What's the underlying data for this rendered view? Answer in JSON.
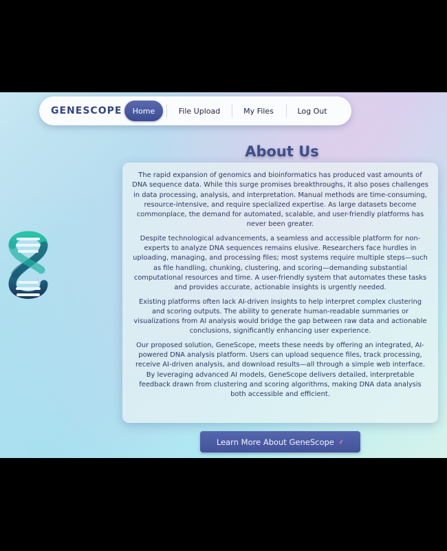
{
  "nav": {
    "brand": "GENESCOPE",
    "items": [
      {
        "label": "Home",
        "active": true
      },
      {
        "label": "File Upload"
      },
      {
        "label": "My Files"
      },
      {
        "label": "Log Out"
      }
    ]
  },
  "logo": {
    "icon": "dna-icon"
  },
  "main": {
    "title": "About Us",
    "paragraphs": [
      "The rapid expansion of genomics and bioinformatics has produced vast amounts of DNA sequence data. While this surge promises breakthroughs, it also poses challenges in data processing, analysis, and interpretation. Manual methods are time-consuming, resource-intensive, and require specialized expertise. As large datasets become commonplace, the demand for automated, scalable, and user-friendly platforms has never been greater.",
      "Despite technological advancements, a seamless and accessible platform for non-experts to analyze DNA sequences remains elusive. Researchers face hurdles in uploading, managing, and processing files; most systems require multiple steps—such as file handling, chunking, clustering, and scoring—demanding substantial computational resources and time. A user-friendly system that automates these tasks and provides accurate, actionable insights is urgently needed.",
      "Existing platforms often lack AI-driven insights to help interpret complex clustering and scoring outputs. The ability to generate human-readable summaries or visualizations from AI analysis would bridge the gap between raw data and actionable conclusions, significantly enhancing user experience.",
      "Our proposed solution, GeneScope, meets these needs by offering an integrated, AI-powered DNA analysis platform. Users can upload sequence files, track processing, receive AI-driven analysis, and download results—all through a simple web interface. By leveraging advanced AI models, GeneScope delivers detailed, interpretable feedback drawn from clustering and scoring algorithms, making DNA data analysis both accessible and efficient."
    ],
    "cta_label": "Learn More About GeneScope",
    "cta_icon": "dna-icon"
  },
  "colors": {
    "primary": "#4a5ba0",
    "brand_text": "#33457f",
    "logo_teal": "#1fa9a0",
    "logo_navy": "#1d3a5c"
  }
}
